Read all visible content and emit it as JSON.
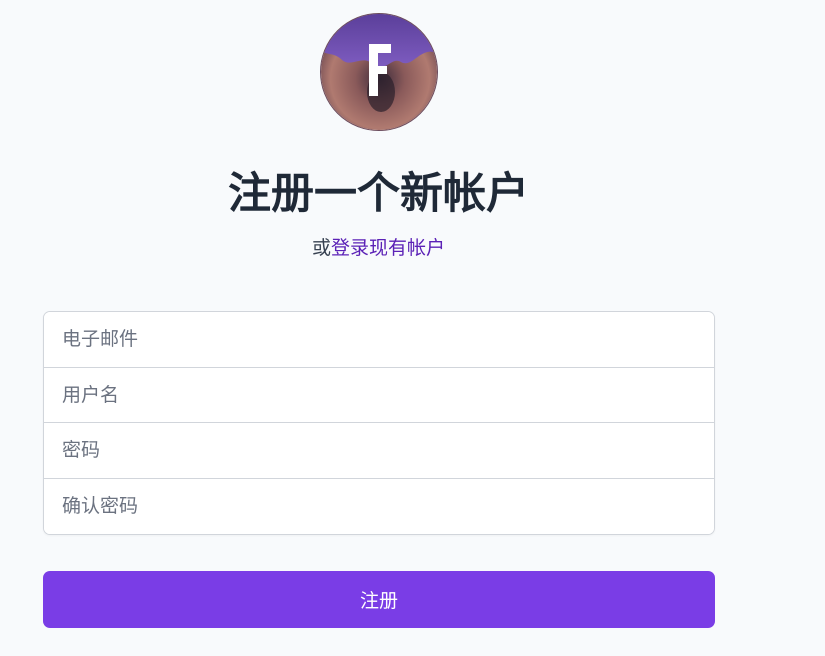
{
  "logo": {
    "letter": "F"
  },
  "header": {
    "title": "注册一个新帐户",
    "subtitle_prefix": "或",
    "login_link": "登录现有帐户"
  },
  "form": {
    "email_placeholder": "电子邮件",
    "username_placeholder": "用户名",
    "password_placeholder": "密码",
    "confirm_password_placeholder": "确认密码",
    "submit_label": "注册"
  },
  "colors": {
    "primary": "#7a3de6",
    "link": "#5b21b6",
    "background": "#f8fafc"
  }
}
